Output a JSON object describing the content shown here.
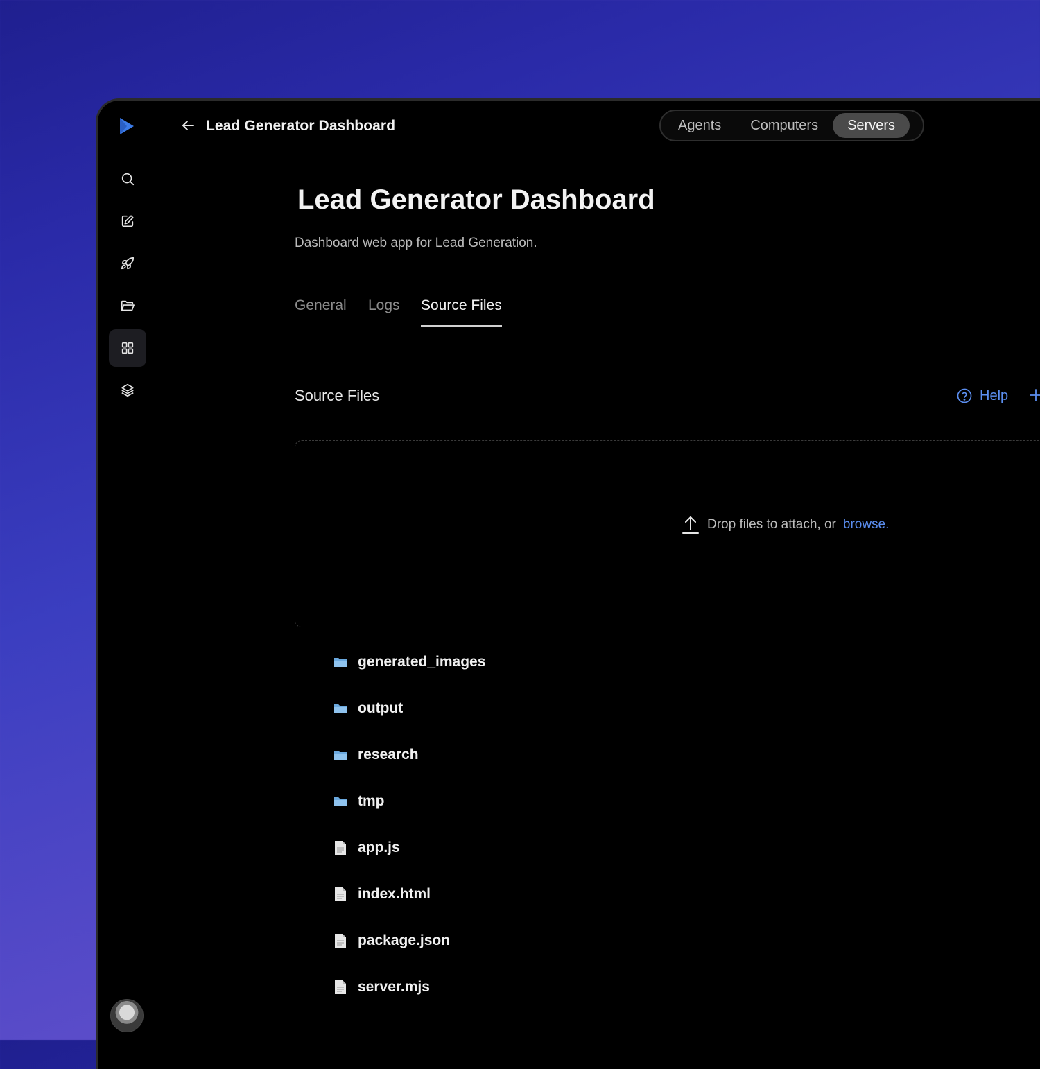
{
  "header": {
    "title": "Lead Generator Dashboard",
    "nav": [
      {
        "label": "Agents",
        "active": false
      },
      {
        "label": "Computers",
        "active": false
      },
      {
        "label": "Servers",
        "active": true
      }
    ]
  },
  "page": {
    "title": "Lead Generator Dashboard",
    "description": "Dashboard web app for Lead Generation.",
    "tabs": [
      {
        "label": "General",
        "active": false
      },
      {
        "label": "Logs",
        "active": false
      },
      {
        "label": "Source Files",
        "active": true
      }
    ]
  },
  "section": {
    "title": "Source Files",
    "help_label": "Help"
  },
  "dropzone": {
    "text": "Drop files to attach, or",
    "link": "browse."
  },
  "files": [
    {
      "name": "generated_images",
      "type": "folder"
    },
    {
      "name": "output",
      "type": "folder"
    },
    {
      "name": "research",
      "type": "folder"
    },
    {
      "name": "tmp",
      "type": "folder"
    },
    {
      "name": "app.js",
      "type": "file"
    },
    {
      "name": "index.html",
      "type": "file"
    },
    {
      "name": "package.json",
      "type": "file"
    },
    {
      "name": "server.mjs",
      "type": "file"
    }
  ],
  "sidebar": {
    "icons": [
      "search-icon",
      "edit-icon",
      "rocket-icon",
      "folder-open-icon",
      "grid-icon",
      "layers-icon"
    ],
    "active_index": 4
  },
  "colors": {
    "accent": "#5b8ef0",
    "logo": "#3b7be8",
    "folder": "#8fc3ee",
    "file": "#e6e6e6"
  }
}
